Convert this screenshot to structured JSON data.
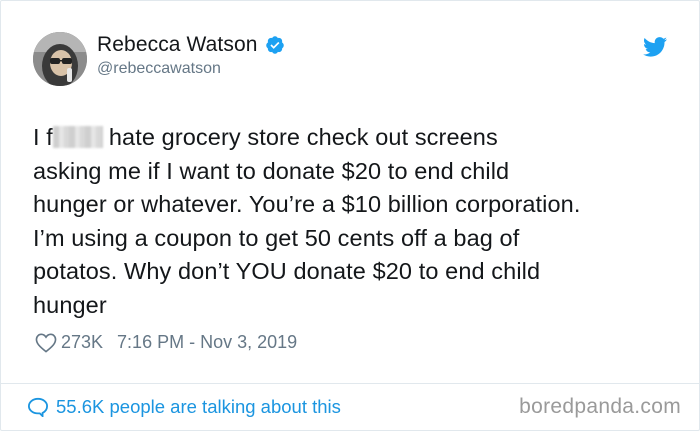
{
  "colors": {
    "verified_blue": "#1da1f2",
    "twitter_blue": "#1da1f2",
    "link_blue": "#1b95e0",
    "meta_gray": "#657786",
    "text_dark": "#14171a"
  },
  "author": {
    "display_name": "Rebecca Watson",
    "handle": "@rebeccawatson",
    "verified_icon": "verified-badge-icon"
  },
  "tweet": {
    "lines": [
      "I f",
      "hate grocery store check out screens",
      "asking me if I want to donate $20 to end child",
      "hunger or whatever. You’re a $10 billion corporation.",
      "I’m using a coupon to get 50 cents off a bag of",
      "potatos. Why don’t YOU donate $20 to end child",
      "hunger"
    ],
    "likes": "273K",
    "timestamp": "7:16 PM - Nov 3, 2019"
  },
  "footer": {
    "talking": "55.6K people are talking about this",
    "watermark": "boredpanda.com"
  }
}
